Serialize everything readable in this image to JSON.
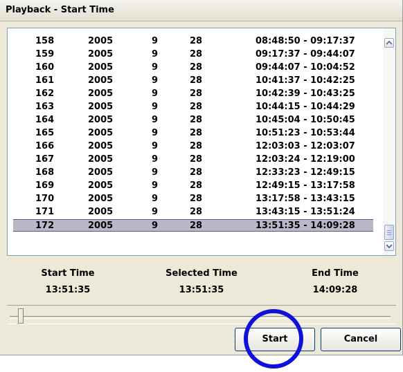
{
  "window": {
    "title": "Playback - Start Time"
  },
  "list": {
    "rows": [
      {
        "no": "158",
        "year": "2005",
        "month": "9",
        "day": "28",
        "range": "08:48:50 - 09:17:37"
      },
      {
        "no": "159",
        "year": "2005",
        "month": "9",
        "day": "28",
        "range": "09:17:37 - 09:44:07"
      },
      {
        "no": "160",
        "year": "2005",
        "month": "9",
        "day": "28",
        "range": "09:44:07 - 10:04:52"
      },
      {
        "no": "161",
        "year": "2005",
        "month": "9",
        "day": "28",
        "range": "10:41:37 - 10:42:25"
      },
      {
        "no": "162",
        "year": "2005",
        "month": "9",
        "day": "28",
        "range": "10:42:39 - 10:43:25"
      },
      {
        "no": "163",
        "year": "2005",
        "month": "9",
        "day": "28",
        "range": "10:44:15 - 10:44:29"
      },
      {
        "no": "164",
        "year": "2005",
        "month": "9",
        "day": "28",
        "range": "10:45:04 - 10:50:45"
      },
      {
        "no": "165",
        "year": "2005",
        "month": "9",
        "day": "28",
        "range": "10:51:23 - 10:53:44"
      },
      {
        "no": "166",
        "year": "2005",
        "month": "9",
        "day": "28",
        "range": "12:03:03 - 12:03:07"
      },
      {
        "no": "167",
        "year": "2005",
        "month": "9",
        "day": "28",
        "range": "12:03:24 - 12:19:00"
      },
      {
        "no": "168",
        "year": "2005",
        "month": "9",
        "day": "28",
        "range": "12:33:23 - 12:49:15"
      },
      {
        "no": "169",
        "year": "2005",
        "month": "9",
        "day": "28",
        "range": "12:49:15 - 13:17:58"
      },
      {
        "no": "170",
        "year": "2005",
        "month": "9",
        "day": "28",
        "range": "13:17:58 - 13:43:15"
      },
      {
        "no": "171",
        "year": "2005",
        "month": "9",
        "day": "28",
        "range": "13:43:15 - 13:51:24"
      },
      {
        "no": "172",
        "year": "2005",
        "month": "9",
        "day": "28",
        "range": "13:51:35 - 14:09:28"
      }
    ],
    "selected_index": 14
  },
  "times": {
    "start_label": "Start Time",
    "start_value": "13:51:35",
    "selected_label": "Selected Time",
    "selected_value": "13:51:35",
    "end_label": "End Time",
    "end_value": "14:09:28"
  },
  "slider": {
    "position": 0
  },
  "buttons": {
    "start_label": "Start",
    "cancel_label": "Cancel"
  },
  "colors": {
    "selected_row": "#b8b8c8",
    "annotation_circle": "#1010dd",
    "dialog_background": "#ece9d8"
  },
  "icons": {
    "scroll_up": "scroll-up-arrow-icon",
    "scroll_down": "scroll-down-arrow-icon",
    "scroll_thumb": "scrollbar-thumb-grip"
  }
}
